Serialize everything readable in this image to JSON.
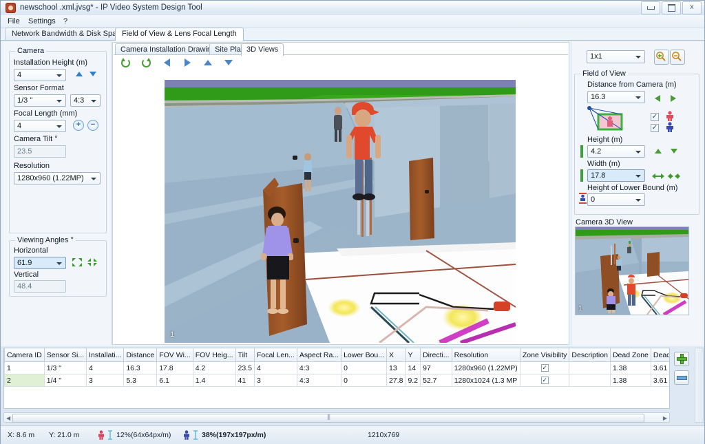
{
  "window": {
    "title": "newschool .xml.jvsg* - IP Video System Design Tool",
    "icon": "app-icon",
    "minimize_label": "Minimize",
    "maximize_label": "Maximize",
    "close_label": "Close"
  },
  "menu": {
    "items": [
      "File",
      "Settings",
      "?"
    ]
  },
  "outer_tabs": [
    {
      "label": "Network Bandwidth & Disk Space",
      "selected": false
    },
    {
      "label": "Field of View & Lens Focal Length",
      "selected": true
    }
  ],
  "inner_tabs": [
    {
      "label": "Camera Installation Drawing",
      "selected": false
    },
    {
      "label": "Site Plan",
      "selected": false
    },
    {
      "label": "3D Views",
      "selected": true
    }
  ],
  "view_toolbar": [
    {
      "name": "rotate-left-icon",
      "title": "Rotate Left"
    },
    {
      "name": "rotate-right-icon",
      "title": "Rotate Right"
    },
    {
      "name": "pan-left-icon",
      "title": "Pan Left"
    },
    {
      "name": "pan-right-icon",
      "title": "Pan Right"
    },
    {
      "name": "pan-up-icon",
      "title": "Pan Up"
    },
    {
      "name": "pan-down-icon",
      "title": "Pan Down"
    }
  ],
  "left_panel": {
    "camera_group": {
      "title": "Camera",
      "installation_height_label": "Installation Height (m)",
      "installation_height_value": "4",
      "sensor_format_label": "Sensor Format",
      "sensor_format_value": "1/3 \"",
      "aspect_ratio_value": "4:3",
      "focal_length_label": "Focal Length (mm)",
      "focal_length_value": "4",
      "camera_tilt_label": "Camera Tilt °",
      "camera_tilt_value": "23.5",
      "resolution_label": "Resolution",
      "resolution_value": "1280x960 (1.22MP)"
    },
    "viewing_angles_group": {
      "title": "Viewing Angles °",
      "horizontal_label": "Horizontal",
      "horizontal_value": "61.9",
      "vertical_label": "Vertical",
      "vertical_value": "48.4"
    }
  },
  "right_panel": {
    "layout_value": "1x1",
    "zoom_in_icon": "zoom-in-icon",
    "zoom_out_icon": "zoom-out-icon",
    "fov_group": {
      "title": "Field of View",
      "distance_label": "Distance from Camera  (m)",
      "distance_value": "16.3",
      "height_label": "Height (m)",
      "height_value": "4.2",
      "width_label": "Width (m)",
      "width_value": "17.8",
      "lower_bound_label": "Height of Lower Bound (m)",
      "lower_bound_value": "0",
      "person_red_checked": true,
      "person_blue_checked": true
    },
    "camera_3d_view": {
      "title": "Camera 3D View",
      "label": "1"
    }
  },
  "viewport": {
    "label": "1"
  },
  "table": {
    "columns": [
      "Camera ID",
      "Sensor Si...",
      "Installati...",
      "Distance",
      "FOV Wi...",
      "FOV Heig...",
      "Tilt",
      "Focal Len...",
      "Aspect Ra...",
      "Lower Bou...",
      "X",
      "Y",
      "Directi...",
      "Resolution",
      "Zone Visibility",
      "Description",
      "Dead Zone",
      "Dead Zone"
    ],
    "rows": [
      {
        "camera_id": "1",
        "sensor_size": "1/3 \"",
        "installation_height": "4",
        "distance": "16.3",
        "fov_width": "17.8",
        "fov_height": "4.2",
        "tilt": "23.5",
        "focal_length": "4",
        "aspect_ratio": "4:3",
        "lower_bound": "0",
        "x": "13",
        "y": "14",
        "direction": "97",
        "resolution": "1280x960 (1.22MP)",
        "zone_visibility": true,
        "description": "",
        "dead_zone_1": "1.38",
        "dead_zone_2": "3.61"
      },
      {
        "camera_id": "2",
        "sensor_size": "1/4 \"",
        "installation_height": "3",
        "distance": "5.3",
        "fov_width": "6.1",
        "fov_height": "1.4",
        "tilt": "41",
        "focal_length": "3",
        "aspect_ratio": "4:3",
        "lower_bound": "0",
        "x": "27.8",
        "y": "9.2",
        "direction": "52.7",
        "resolution": "1280x1024 (1.3 MP",
        "zone_visibility": true,
        "description": "",
        "dead_zone_1": "1.38",
        "dead_zone_2": "3.61"
      }
    ],
    "add_button_label": "+",
    "remove_button_label": "-"
  },
  "status_bar": {
    "x": "X: 8.6 m",
    "y": "Y: 21.0 m",
    "red_density": "12%(64x64px/m)",
    "blue_density": "38%(197x197px/m)",
    "canvas_size": "1210x769"
  },
  "colors": {
    "accent_green": "#4a9c36",
    "accent_blue": "#4a86c8",
    "row_select": "#d9f2cf",
    "field_highlight": "#d9ebfb"
  }
}
